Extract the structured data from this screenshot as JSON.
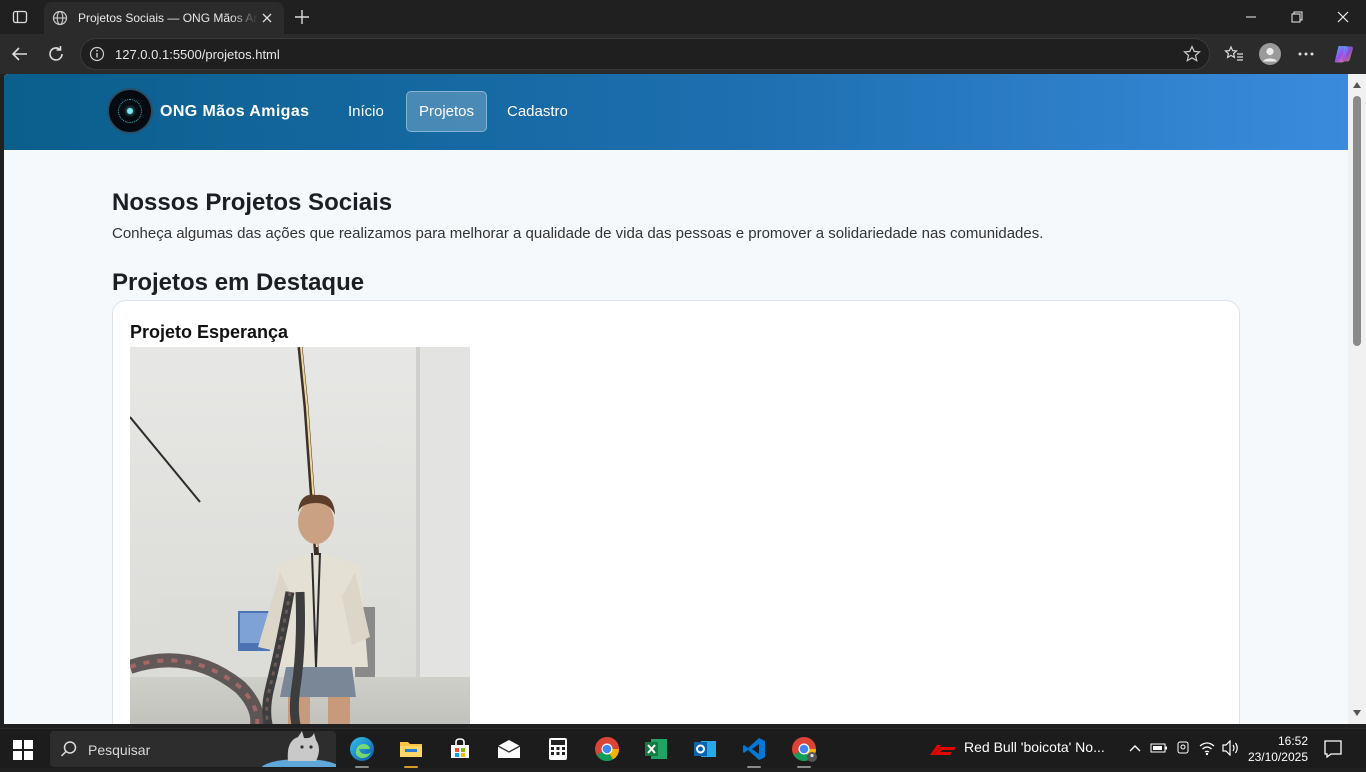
{
  "browser": {
    "tab_title": "Projetos Sociais — ONG Mãos Amigas",
    "url": "127.0.0.1:5500/projetos.html"
  },
  "site": {
    "brand": "ONG Mãos Amigas",
    "nav": [
      {
        "label": "Início",
        "active": false
      },
      {
        "label": "Projetos",
        "active": true
      },
      {
        "label": "Cadastro",
        "active": false
      }
    ],
    "colors": {
      "header_start": "#0a5f8c",
      "header_end": "#3a8bdc",
      "page_bg": "#f5f9fc"
    }
  },
  "page": {
    "title": "Nossos Projetos Sociais",
    "lead": "Conheça algumas das ações que realizamos para melhorar a qualidade de vida das pessoas e promover a solidariedade nas comunidades.",
    "section_title": "Projetos em Destaque",
    "projects": [
      {
        "title": "Projeto Esperança",
        "image": "photo-man-battle-ropes-gym"
      }
    ]
  },
  "taskbar": {
    "search_placeholder": "Pesquisar",
    "apps": [
      "edge-icon",
      "file-explorer-icon",
      "store-icon",
      "mail-icon",
      "calculator-icon",
      "chrome-icon",
      "excel-icon",
      "outlook-icon",
      "vscode-icon",
      "chrome-profile-icon"
    ],
    "news": "Red Bull 'boicota' No...",
    "time": "16:52",
    "date": "23/10/2025"
  }
}
